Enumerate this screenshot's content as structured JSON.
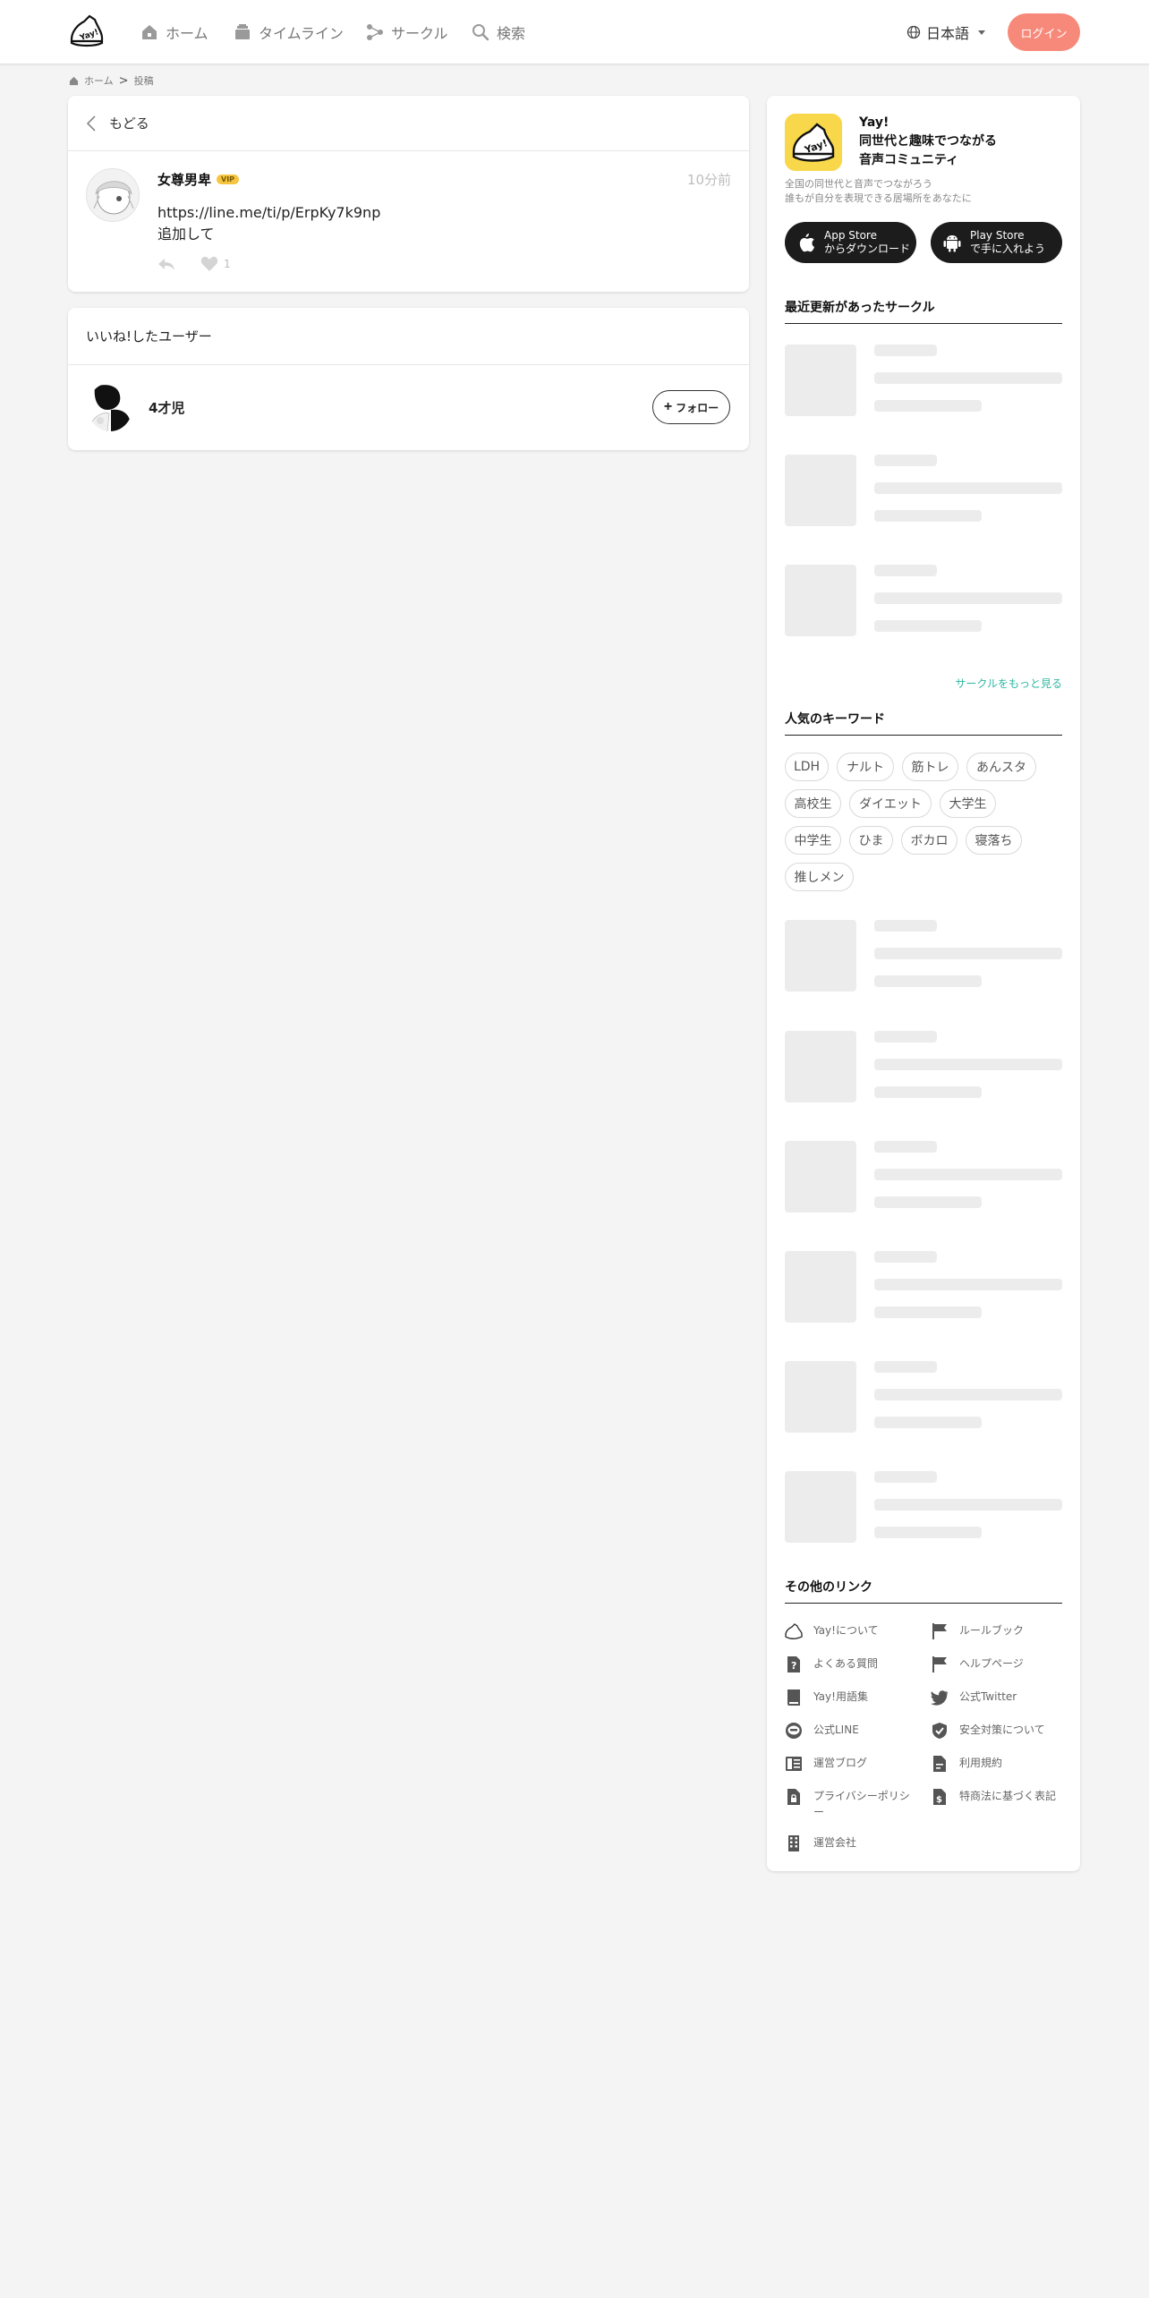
{
  "header": {
    "nav": [
      {
        "label": "ホーム",
        "icon": "home-icon"
      },
      {
        "label": "タイムライン",
        "icon": "timeline-icon"
      },
      {
        "label": "サークル",
        "icon": "circle-icon"
      },
      {
        "label": "検索",
        "icon": "search-icon"
      }
    ],
    "language": "日本語",
    "login": "ログイン",
    "login_color": "#f7897a"
  },
  "breadcrumb": {
    "home": "ホーム",
    "separator": ">",
    "current": "投稿"
  },
  "post": {
    "back_label": "もどる",
    "author": "女尊男卑",
    "badge": "VIP",
    "time": "10分前",
    "lines": [
      "https://line.me/ti/p/ErpKy7k9np",
      "追加して"
    ],
    "like_count": "1"
  },
  "likes": {
    "title": "いいね!したユーザー",
    "users": [
      {
        "name": "4才児",
        "follow_label": "フォロー"
      }
    ]
  },
  "sidebar": {
    "app": {
      "name_line1": "Yay!",
      "name_line2": "同世代と趣味でつながる",
      "name_line3": "音声コミュニティ",
      "desc_line1": "全国の同世代と音声でつながろう",
      "desc_line2": "誰もが自分を表現できる居場所をあなたに",
      "appstore_line1": "App Store",
      "appstore_line2": "からダウンロード",
      "playstore_line1": "Play Store",
      "playstore_line2": "で手に入れよう"
    },
    "recent_circles_title": "最近更新があったサークル",
    "more_circles": "サークルをもっと見る",
    "keywords_title": "人気のキーワード",
    "keywords": [
      "LDH",
      "ナルト",
      "筋トレ",
      "あんスタ",
      "高校生",
      "ダイエット",
      "大学生",
      "中学生",
      "ひま",
      "ボカロ",
      "寝落ち",
      "推しメン"
    ],
    "links_title": "その他のリンク",
    "links": [
      {
        "label": "Yay!について",
        "icon": "yay-shoe-icon"
      },
      {
        "label": "ルールブック",
        "icon": "flag-icon"
      },
      {
        "label": "よくある質問",
        "icon": "question-icon"
      },
      {
        "label": "ヘルプページ",
        "icon": "flag-icon"
      },
      {
        "label": "Yay!用語集",
        "icon": "book-icon"
      },
      {
        "label": "公式Twitter",
        "icon": "twitter-icon"
      },
      {
        "label": "公式LINE",
        "icon": "line-icon"
      },
      {
        "label": "安全対策について",
        "icon": "shield-icon"
      },
      {
        "label": "運営ブログ",
        "icon": "blog-icon"
      },
      {
        "label": "利用規約",
        "icon": "document-icon"
      },
      {
        "label": "プライバシーポリシー",
        "icon": "lock-document-icon"
      },
      {
        "label": "特商法に基づく表記",
        "icon": "dollar-document-icon"
      },
      {
        "label": "運営会社",
        "icon": "building-icon"
      }
    ]
  }
}
